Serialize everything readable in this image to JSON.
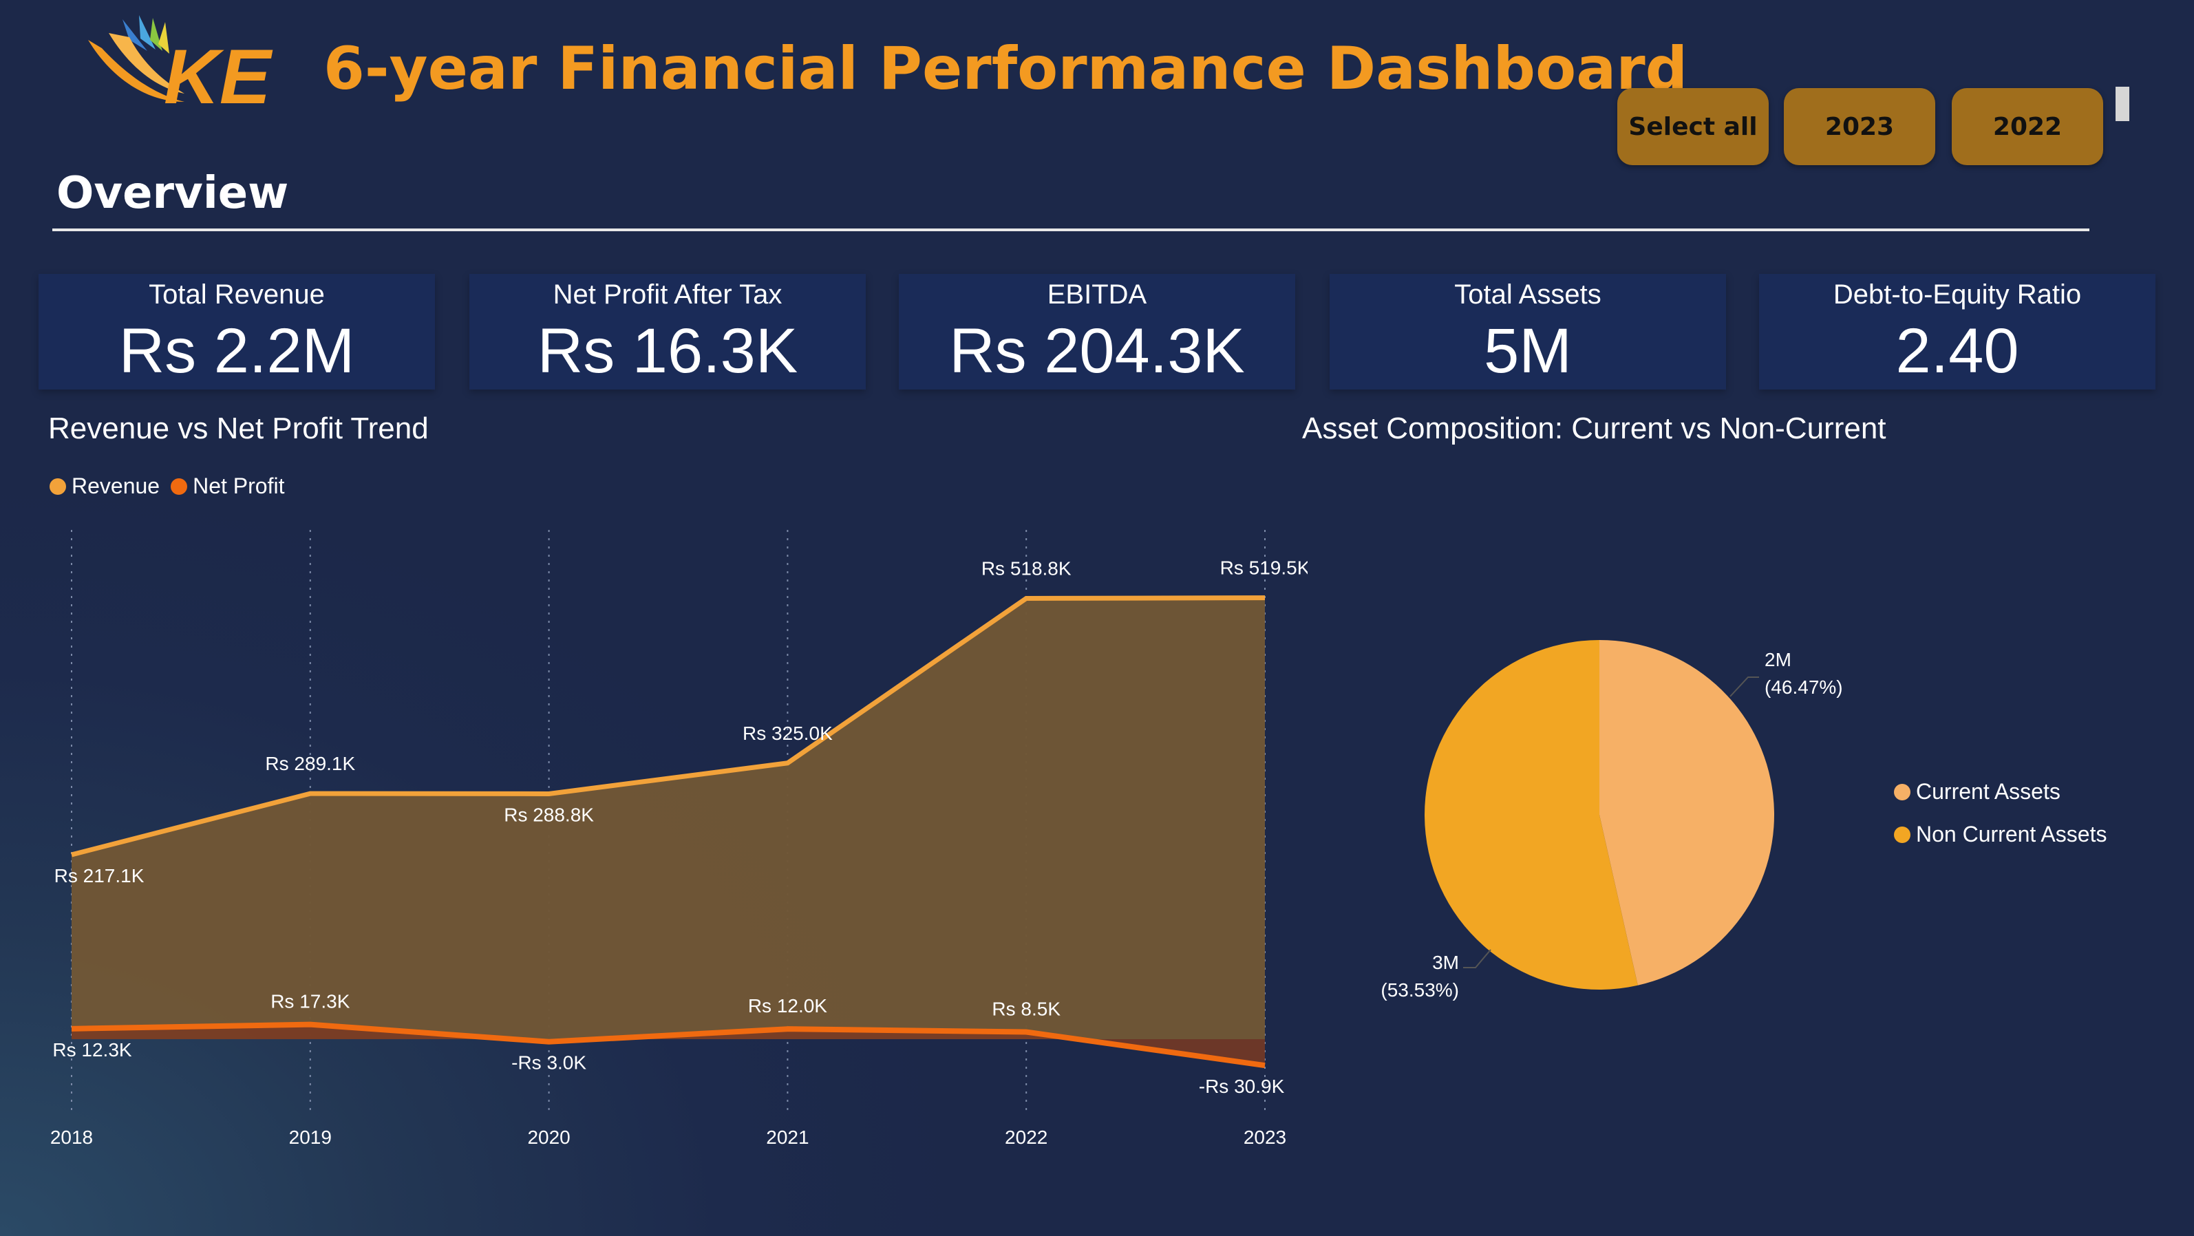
{
  "header": {
    "title": "6-year Financial Performance Dashboard",
    "logo_text": "KE",
    "filters": [
      "Select all",
      "2023",
      "2022"
    ]
  },
  "section_title": "Overview",
  "kpis": [
    {
      "label": "Total Revenue",
      "value": "Rs 2.2M"
    },
    {
      "label": "Net Profit After Tax",
      "value": "Rs 16.3K"
    },
    {
      "label": "EBITDA",
      "value": "Rs 204.3K"
    },
    {
      "label": "Total Assets",
      "value": "5M"
    },
    {
      "label": "Debt-to-Equity Ratio",
      "value": "2.40"
    }
  ],
  "colors": {
    "accent": "#f39a21",
    "revenue": "#f2a23a",
    "net_profit": "#f06a10",
    "area_fill": "#715736",
    "kpi_card": "#1a2b58",
    "slicer": "#a06e1c",
    "current_assets": "#f6b066",
    "non_current_assets": "#f2a623"
  },
  "chart_data": [
    {
      "type": "area",
      "title": "Revenue vs Net Profit Trend",
      "categories": [
        "2018",
        "2019",
        "2020",
        "2021",
        "2022",
        "2023"
      ],
      "series": [
        {
          "name": "Revenue",
          "values": [
            217.1,
            289.1,
            288.8,
            325.0,
            518.8,
            519.5
          ],
          "labels": [
            "Rs 217.1K",
            "Rs 289.1K",
            "Rs 288.8K",
            "Rs 325.0K",
            "Rs 518.8K",
            "Rs 519.5K"
          ]
        },
        {
          "name": "Net Profit",
          "values": [
            12.3,
            17.3,
            -3.0,
            12.0,
            8.5,
            -30.9
          ],
          "labels": [
            "Rs 12.3K",
            "Rs 17.3K",
            "-Rs 3.0K",
            "Rs 12.0K",
            "Rs 8.5K",
            "-Rs 30.9K"
          ]
        }
      ],
      "legend_position": "top-left",
      "grid": "vertical dotted"
    },
    {
      "type": "pie",
      "title": "Asset Composition: Current vs Non-Current",
      "slices": [
        {
          "name": "Current Assets",
          "value": 46.47,
          "label": "2M",
          "pct_label": "(46.47%)"
        },
        {
          "name": "Non Current Assets",
          "value": 53.53,
          "label": "3M",
          "pct_label": "(53.53%)"
        }
      ],
      "legend_position": "right"
    }
  ]
}
